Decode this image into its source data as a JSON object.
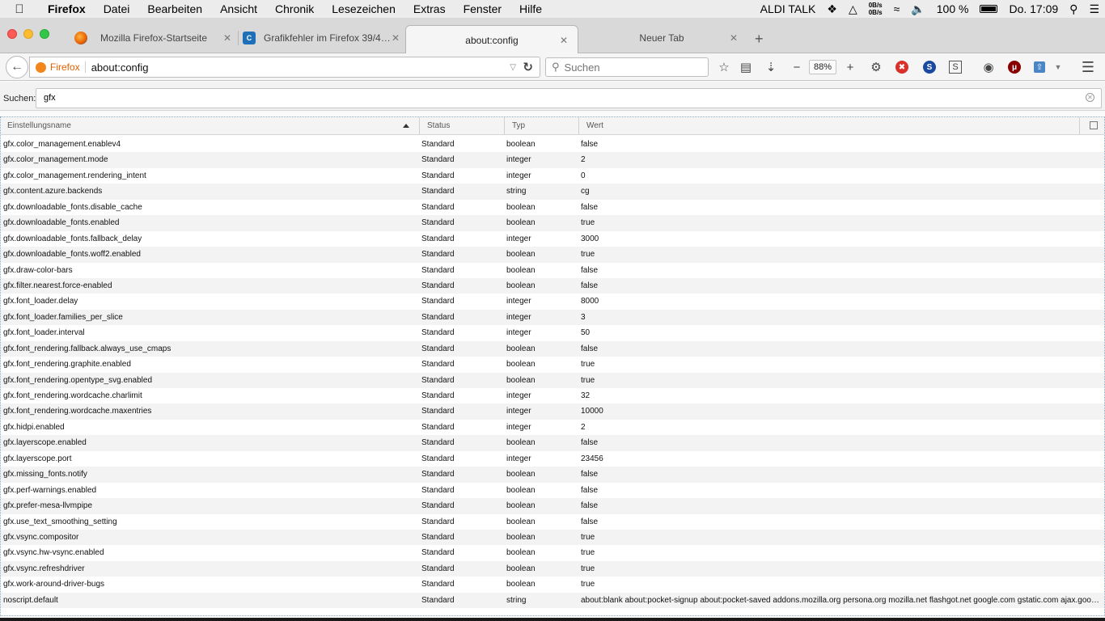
{
  "menubar": {
    "apple": "",
    "app_name": "Firefox",
    "items": [
      "Datei",
      "Bearbeiten",
      "Ansicht",
      "Chronik",
      "Lesezeichen",
      "Extras",
      "Fenster",
      "Hilfe"
    ],
    "carrier": "ALDI TALK",
    "net_up": "0B/s",
    "net_down": "0B/s",
    "battery": "100 %",
    "clock": "Do. 17:09"
  },
  "tabs": [
    {
      "title": "Mozilla Firefox-Startseite",
      "icon": "firefox-icon",
      "color": "#e66000"
    },
    {
      "title": "Grafikfehler im Firefox 39/4…",
      "icon": "computerbase-icon",
      "color": "#1d6fb8"
    },
    {
      "title": "about:config",
      "active": true
    },
    {
      "title": "Neuer Tab"
    }
  ],
  "navbar": {
    "identity_label": "Firefox",
    "url": "about:config",
    "search_placeholder": "Suchen",
    "zoom": "88%"
  },
  "filter": {
    "label": "Suchen:",
    "value": "gfx"
  },
  "columns": {
    "name": "Einstellungsname",
    "status": "Status",
    "type": "Typ",
    "value": "Wert"
  },
  "prefs": [
    {
      "name": "gfx.color_management.enablev4",
      "status": "Standard",
      "type": "boolean",
      "value": "false"
    },
    {
      "name": "gfx.color_management.mode",
      "status": "Standard",
      "type": "integer",
      "value": "2"
    },
    {
      "name": "gfx.color_management.rendering_intent",
      "status": "Standard",
      "type": "integer",
      "value": "0"
    },
    {
      "name": "gfx.content.azure.backends",
      "status": "Standard",
      "type": "string",
      "value": "cg"
    },
    {
      "name": "gfx.downloadable_fonts.disable_cache",
      "status": "Standard",
      "type": "boolean",
      "value": "false"
    },
    {
      "name": "gfx.downloadable_fonts.enabled",
      "status": "Standard",
      "type": "boolean",
      "value": "true"
    },
    {
      "name": "gfx.downloadable_fonts.fallback_delay",
      "status": "Standard",
      "type": "integer",
      "value": "3000"
    },
    {
      "name": "gfx.downloadable_fonts.woff2.enabled",
      "status": "Standard",
      "type": "boolean",
      "value": "true"
    },
    {
      "name": "gfx.draw-color-bars",
      "status": "Standard",
      "type": "boolean",
      "value": "false"
    },
    {
      "name": "gfx.filter.nearest.force-enabled",
      "status": "Standard",
      "type": "boolean",
      "value": "false"
    },
    {
      "name": "gfx.font_loader.delay",
      "status": "Standard",
      "type": "integer",
      "value": "8000"
    },
    {
      "name": "gfx.font_loader.families_per_slice",
      "status": "Standard",
      "type": "integer",
      "value": "3"
    },
    {
      "name": "gfx.font_loader.interval",
      "status": "Standard",
      "type": "integer",
      "value": "50"
    },
    {
      "name": "gfx.font_rendering.fallback.always_use_cmaps",
      "status": "Standard",
      "type": "boolean",
      "value": "false"
    },
    {
      "name": "gfx.font_rendering.graphite.enabled",
      "status": "Standard",
      "type": "boolean",
      "value": "true"
    },
    {
      "name": "gfx.font_rendering.opentype_svg.enabled",
      "status": "Standard",
      "type": "boolean",
      "value": "true"
    },
    {
      "name": "gfx.font_rendering.wordcache.charlimit",
      "status": "Standard",
      "type": "integer",
      "value": "32"
    },
    {
      "name": "gfx.font_rendering.wordcache.maxentries",
      "status": "Standard",
      "type": "integer",
      "value": "10000"
    },
    {
      "name": "gfx.hidpi.enabled",
      "status": "Standard",
      "type": "integer",
      "value": "2"
    },
    {
      "name": "gfx.layerscope.enabled",
      "status": "Standard",
      "type": "boolean",
      "value": "false"
    },
    {
      "name": "gfx.layerscope.port",
      "status": "Standard",
      "type": "integer",
      "value": "23456"
    },
    {
      "name": "gfx.missing_fonts.notify",
      "status": "Standard",
      "type": "boolean",
      "value": "false"
    },
    {
      "name": "gfx.perf-warnings.enabled",
      "status": "Standard",
      "type": "boolean",
      "value": "false"
    },
    {
      "name": "gfx.prefer-mesa-llvmpipe",
      "status": "Standard",
      "type": "boolean",
      "value": "false"
    },
    {
      "name": "gfx.use_text_smoothing_setting",
      "status": "Standard",
      "type": "boolean",
      "value": "false"
    },
    {
      "name": "gfx.vsync.compositor",
      "status": "Standard",
      "type": "boolean",
      "value": "true"
    },
    {
      "name": "gfx.vsync.hw-vsync.enabled",
      "status": "Standard",
      "type": "boolean",
      "value": "true"
    },
    {
      "name": "gfx.vsync.refreshdriver",
      "status": "Standard",
      "type": "boolean",
      "value": "true"
    },
    {
      "name": "gfx.work-around-driver-bugs",
      "status": "Standard",
      "type": "boolean",
      "value": "true"
    },
    {
      "name": "noscript.default",
      "status": "Standard",
      "type": "string",
      "value": "about:blank about:pocket-signup about:pocket-saved addons.mozilla.org persona.org mozilla.net flashgot.net google.com gstatic.com ajax.goo…"
    }
  ]
}
